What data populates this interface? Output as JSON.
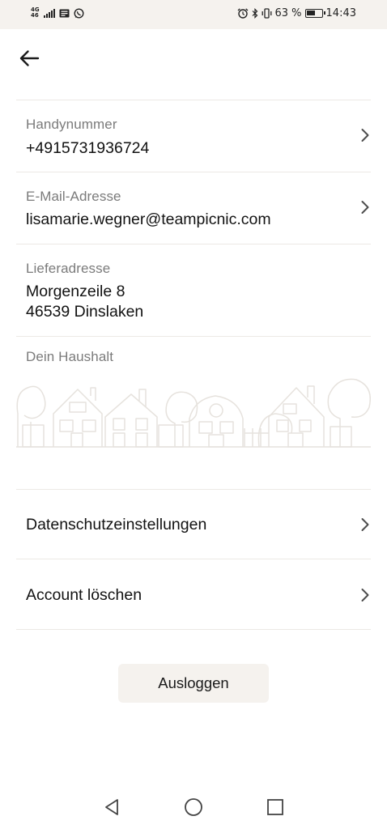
{
  "status_bar": {
    "network_top": "4G",
    "network_bottom": "46",
    "battery_percent": "63 %",
    "battery_level": 0.63,
    "time": "14:43"
  },
  "profile": {
    "phone": {
      "label": "Handynummer",
      "value": "+4915731936724"
    },
    "email": {
      "label": "E-Mail-Adresse",
      "value": "lisamarie.wegner@teampicnic.com"
    },
    "address": {
      "label": "Lieferadresse",
      "street": "Morgenzeile 8",
      "city": "46539 Dinslaken"
    },
    "household": {
      "label": "Dein Haushalt"
    }
  },
  "settings": {
    "privacy_label": "Datenschutzeinstellungen",
    "delete_account_label": "Account löschen"
  },
  "logout_label": "Ausloggen",
  "icons": {
    "back": "arrow-left-icon",
    "chevron": "chevron-right-icon",
    "nav_back": "triangle-back-icon",
    "nav_home": "circle-home-icon",
    "nav_recent": "square-recent-icon"
  },
  "colors": {
    "status_bar_bg": "#f5f2ee",
    "label_gray": "#7b7b7b",
    "text_dark": "#121212",
    "divider": "#ece9e5",
    "button_bg": "#f5f2ee"
  }
}
